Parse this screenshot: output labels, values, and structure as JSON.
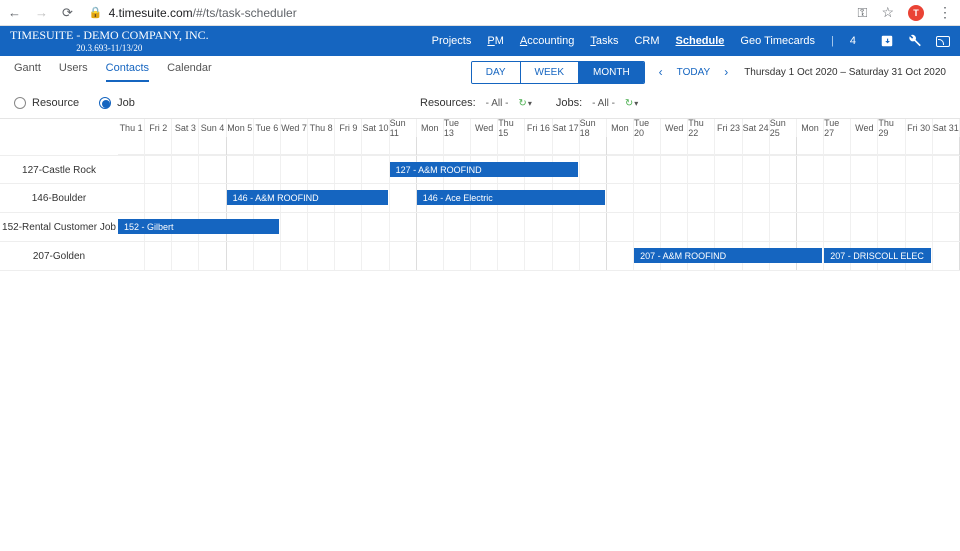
{
  "browser": {
    "domain": "4.timesuite.com",
    "path": "/#/ts/task-scheduler",
    "avatar_initial": "T"
  },
  "app": {
    "title": "TIMESUITE - DEMO COMPANY, INC.",
    "version": "20.3.693-11/13/20",
    "nav": [
      "Projects",
      "PM",
      "Accounting",
      "Tasks",
      "CRM",
      "Schedule",
      "Geo Timecards"
    ],
    "active_nav": "Schedule",
    "count": "4"
  },
  "subtabs": {
    "items": [
      "Gantt",
      "Users",
      "Contacts",
      "Calendar"
    ],
    "active": "Contacts"
  },
  "period_buttons": {
    "day": "DAY",
    "week": "WEEK",
    "month": "MONTH"
  },
  "today_label": "TODAY",
  "date_range": "Thursday 1 Oct 2020 – Saturday 31 Oct 2020",
  "filters": {
    "radios": {
      "resource": "Resource",
      "job": "Job",
      "selected": "job"
    },
    "resources_label": "Resources:",
    "resources_value": "- All -",
    "jobs_label": "Jobs:",
    "jobs_value": "- All -"
  },
  "schedule": {
    "columns": [
      "Thu 1",
      "Fri 2",
      "Sat 3",
      "Sun 4",
      "Mon 5",
      "Tue 6",
      "Wed 7",
      "Thu 8",
      "Fri 9",
      "Sat 10",
      "Sun 11",
      "Mon",
      "Tue 13",
      "Wed",
      "Thu 15",
      "Fri 16",
      "Sat 17",
      "Sun 18",
      "Mon",
      "Tue 20",
      "Wed",
      "Thu 22",
      "Fri 23",
      "Sat 24",
      "Sun 25",
      "Mon",
      "Tue 27",
      "Wed",
      "Thu 29",
      "Fri 30",
      "Sat 31"
    ],
    "rows": [
      {
        "label": "127-Castle Rock",
        "tasks": [
          {
            "label": "127 - A&M ROOFIND",
            "start": 10,
            "span": 7
          }
        ]
      },
      {
        "label": "146-Boulder",
        "tasks": [
          {
            "label": "146 - A&M ROOFIND",
            "start": 4,
            "span": 6
          },
          {
            "label": "146 - Ace Electric",
            "start": 11,
            "span": 7
          }
        ]
      },
      {
        "label": "152-Rental Customer Job",
        "tasks": [
          {
            "label": "152 - Gilbert",
            "start": 0,
            "span": 6
          }
        ]
      },
      {
        "label": "207-Golden",
        "tasks": [
          {
            "label": "207 - A&M ROOFIND",
            "start": 19,
            "span": 7
          },
          {
            "label": "207 - DRISCOLL ELEC",
            "start": 26,
            "span": 4
          }
        ]
      }
    ]
  }
}
